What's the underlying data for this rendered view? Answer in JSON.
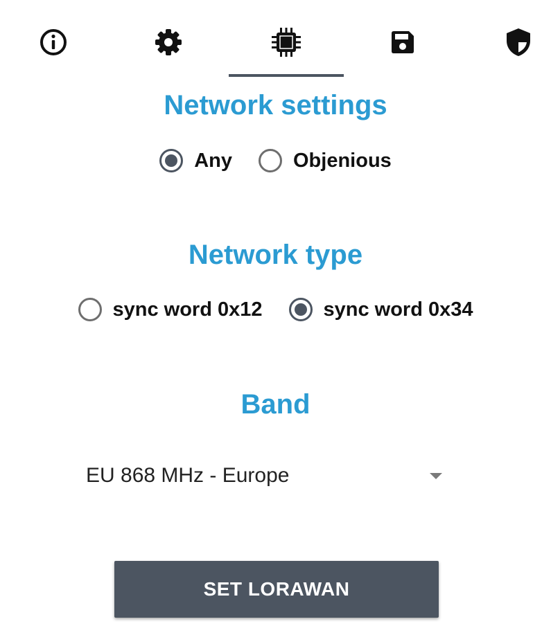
{
  "tabs": [
    {
      "icon": "info-icon",
      "active": false
    },
    {
      "icon": "gear-icon",
      "active": false
    },
    {
      "icon": "chip-icon",
      "active": true
    },
    {
      "icon": "save-icon",
      "active": false
    },
    {
      "icon": "shield-icon",
      "active": false
    }
  ],
  "network_settings": {
    "title": "Network settings",
    "options": [
      {
        "label": "Any",
        "checked": true
      },
      {
        "label": "Objenious",
        "checked": false
      }
    ]
  },
  "network_type": {
    "title": "Network type",
    "options": [
      {
        "label": "sync word 0x12",
        "checked": false
      },
      {
        "label": "sync word 0x34",
        "checked": true
      }
    ]
  },
  "band": {
    "title": "Band",
    "selected": "EU 868 MHz - Europe"
  },
  "actions": {
    "set_label": "SET LORAWAN"
  },
  "colors": {
    "accent": "#2b9bd2",
    "primary_dark": "#4c5561",
    "text": "#111111"
  }
}
